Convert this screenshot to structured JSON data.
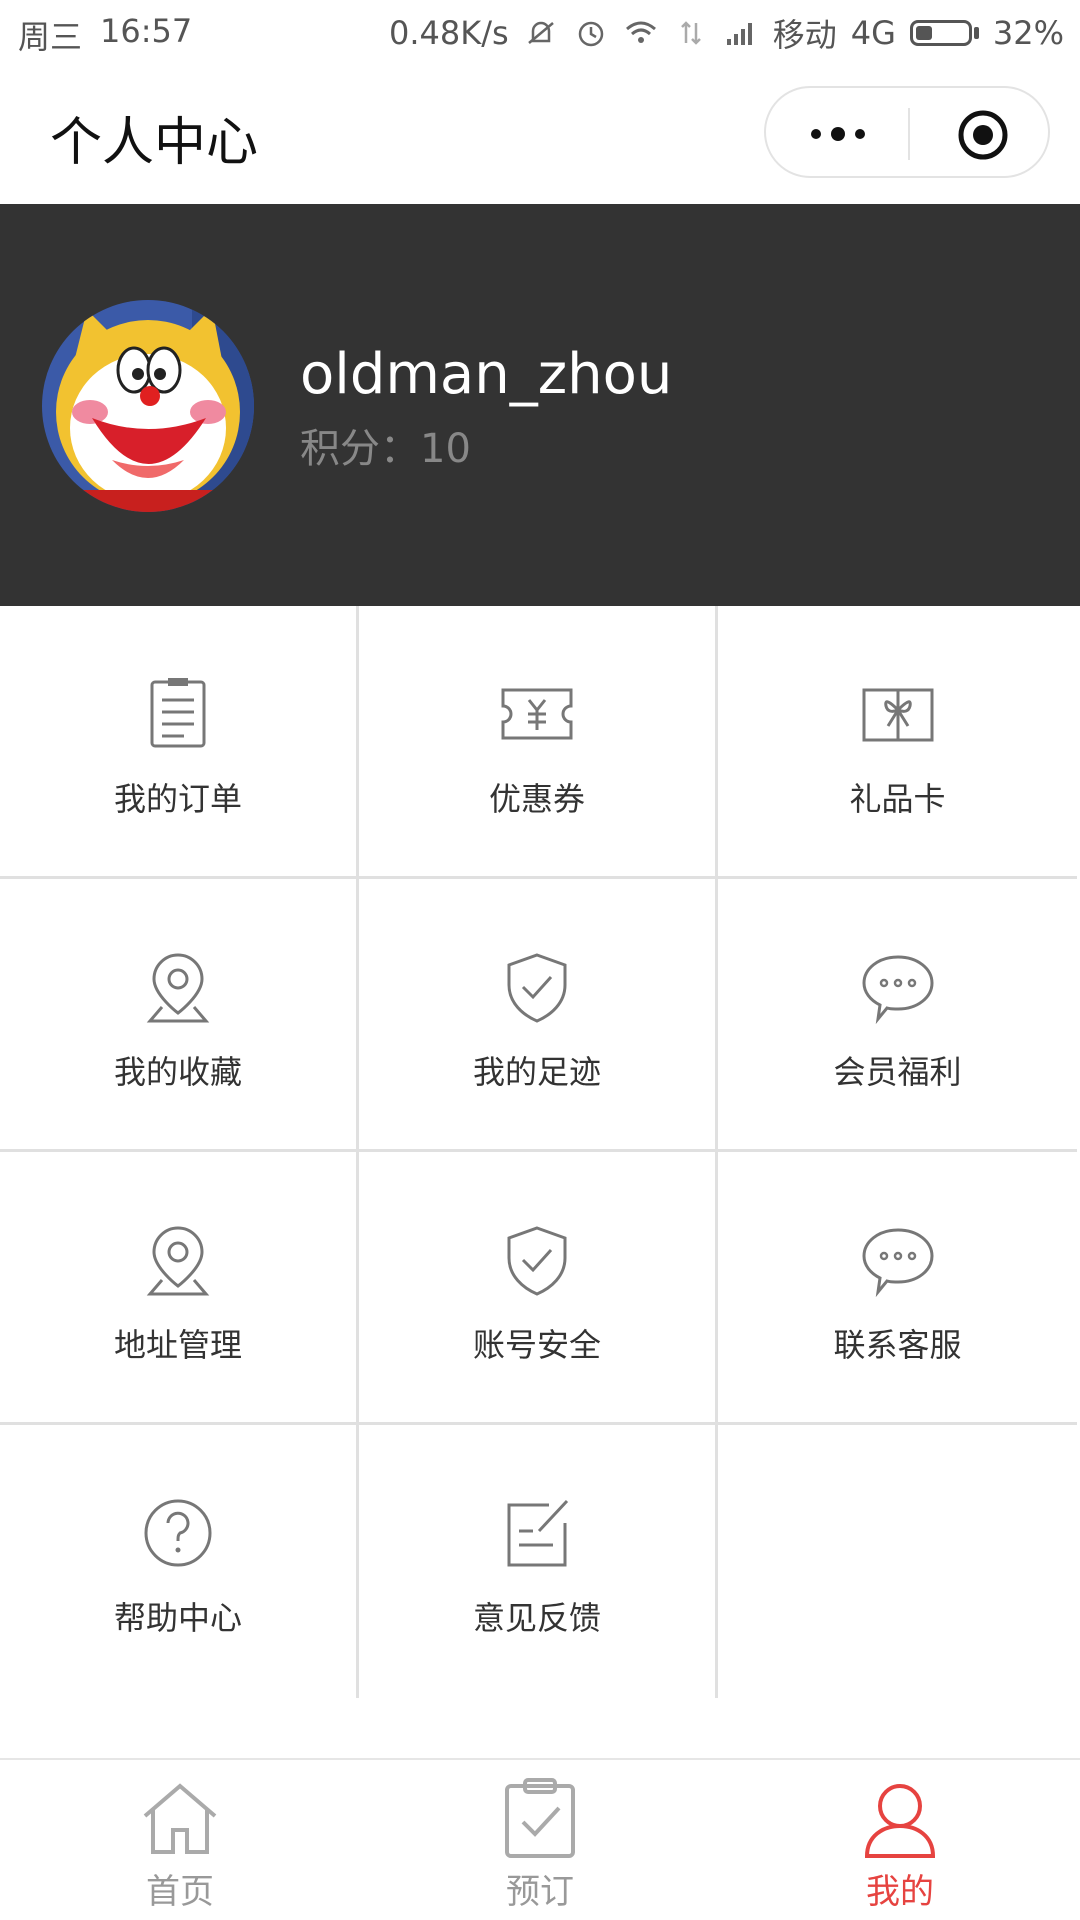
{
  "status_bar": {
    "day": "周三",
    "time": "16:57",
    "net_speed": "0.48K/s",
    "carrier": "移动",
    "network": "4G",
    "battery_percent": "32%",
    "battery_level": 0.32
  },
  "title_bar": {
    "title": "个人中心",
    "more_icon": "more-dots-icon",
    "close_icon": "target-close-icon"
  },
  "profile": {
    "username": "oldman_zhou",
    "points_label": "积分：10",
    "avatar_icon": "cartoon-cat-avatar"
  },
  "menu": {
    "items": [
      {
        "label": "我的订单",
        "icon": "order-list-icon"
      },
      {
        "label": "优惠券",
        "icon": "coupon-icon"
      },
      {
        "label": "礼品卡",
        "icon": "gift-card-icon"
      },
      {
        "label": "我的收藏",
        "icon": "location-pin-icon"
      },
      {
        "label": "我的足迹",
        "icon": "shield-check-icon"
      },
      {
        "label": "会员福利",
        "icon": "chat-bubble-icon"
      },
      {
        "label": "地址管理",
        "icon": "location-pin-icon"
      },
      {
        "label": "账号安全",
        "icon": "shield-check-icon"
      },
      {
        "label": "联系客服",
        "icon": "chat-bubble-icon"
      },
      {
        "label": "帮助中心",
        "icon": "help-circle-icon"
      },
      {
        "label": "意见反馈",
        "icon": "feedback-edit-icon"
      }
    ]
  },
  "tab_bar": {
    "tabs": [
      {
        "label": "首页",
        "icon": "home-icon",
        "active": false
      },
      {
        "label": "预订",
        "icon": "clipboard-check-icon",
        "active": false
      },
      {
        "label": "我的",
        "icon": "user-icon",
        "active": true
      }
    ],
    "active_color": "#e64340",
    "inactive_color": "#999999"
  }
}
